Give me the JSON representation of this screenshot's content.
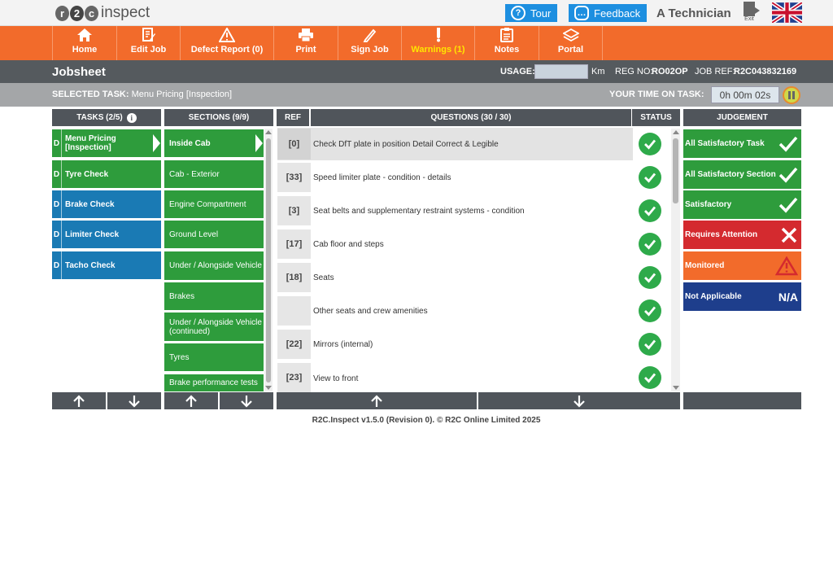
{
  "brand": {
    "logo_letters": [
      "r",
      "2",
      "c"
    ],
    "logo_text": "inspect"
  },
  "topbar": {
    "tour_label": "Tour",
    "feedback_label": "Feedback",
    "user_name": "A Technician",
    "exit_label": "Exit"
  },
  "nav": [
    {
      "label": "Home",
      "icon": "home-icon"
    },
    {
      "label": "Edit Job",
      "icon": "edit-job-icon"
    },
    {
      "label": "Defect Report (0)",
      "icon": "warning-triangle-icon"
    },
    {
      "label": "Print",
      "icon": "printer-icon"
    },
    {
      "label": "Sign Job",
      "icon": "pen-icon"
    },
    {
      "label": "Warnings (1)",
      "icon": "exclamation-icon"
    },
    {
      "label": "Notes",
      "icon": "clipboard-icon"
    },
    {
      "label": "Portal",
      "icon": "layers-icon"
    }
  ],
  "jobbar": {
    "title": "Jobsheet",
    "usage_label": "USAGE:",
    "usage_value": "",
    "usage_unit": "Km",
    "reg_label": "REG NO:",
    "reg_value": "RO02OP",
    "jobref_label": "JOB REF:",
    "jobref_value": "R2C043832169"
  },
  "taskbar": {
    "selected_label": "SELECTED TASK:",
    "selected_value": "Menu Pricing [Inspection]",
    "time_label": "YOUR TIME ON TASK:",
    "time_value": "0h 00m 02s"
  },
  "headers": {
    "tasks": "TASKS (2/5)",
    "sections": "SECTIONS (9/9)",
    "ref": "REF",
    "questions": "QUESTIONS (30 / 30)",
    "status": "STATUS",
    "judgement": "JUDGEMENT"
  },
  "tasks": [
    {
      "prefix": "D",
      "label": "Menu Pricing [Inspection]",
      "color": "#2e9c3c",
      "selected": true
    },
    {
      "prefix": "D",
      "label": "Tyre Check",
      "color": "#2e9c3c"
    },
    {
      "prefix": "D",
      "label": "Brake Check",
      "color": "#1a7ab4"
    },
    {
      "prefix": "D",
      "label": "Limiter Check",
      "color": "#1a7ab4"
    },
    {
      "prefix": "D",
      "label": "Tacho Check",
      "color": "#1a7ab4"
    }
  ],
  "sections": [
    {
      "label": "Inside Cab",
      "selected": true
    },
    {
      "label": "Cab - Exterior"
    },
    {
      "label": "Engine Compartment"
    },
    {
      "label": "Ground Level"
    },
    {
      "label": "Under / Alongside Vehicle"
    },
    {
      "label": "Brakes"
    },
    {
      "label": "Under / Alongside Vehicle (continued)"
    },
    {
      "label": "Tyres"
    },
    {
      "label": "Brake performance tests"
    }
  ],
  "questions": [
    {
      "ref": "[0]",
      "text": "Check DfT plate in position Detail Correct & Legible",
      "status": "satisfactory"
    },
    {
      "ref": "[33]",
      "text": "Speed limiter plate - condition - details",
      "status": "satisfactory"
    },
    {
      "ref": "[3]",
      "text": "Seat belts and supplementary restraint systems - condition",
      "status": "satisfactory"
    },
    {
      "ref": "[17]",
      "text": "Cab floor and steps",
      "status": "satisfactory"
    },
    {
      "ref": "[18]",
      "text": "Seats",
      "status": "satisfactory"
    },
    {
      "ref": "",
      "text": "Other seats and crew amenities",
      "status": "satisfactory"
    },
    {
      "ref": "[22]",
      "text": "Mirrors (internal)",
      "status": "satisfactory"
    },
    {
      "ref": "[23]",
      "text": "View to front",
      "status": "satisfactory"
    }
  ],
  "judgements": [
    {
      "label": "All Satisfactory Task",
      "icon": "check-icon",
      "color": "#2e9c3c"
    },
    {
      "label": "All Satisfactory Section",
      "icon": "check-icon",
      "color": "#2e9c3c"
    },
    {
      "label": "Satisfactory",
      "icon": "check-icon",
      "color": "#2e9c3c"
    },
    {
      "label": "Requires Attention",
      "icon": "cross-icon",
      "color": "#d42a2f"
    },
    {
      "label": "Monitored",
      "icon": "warning-triangle-icon",
      "color": "#f26b2b"
    },
    {
      "label": "Not Applicable",
      "icon_text": "N/A",
      "color": "#1e3e8c"
    }
  ],
  "footer": "R2C.Inspect v1.5.0 (Revision 0). © R2C Online Limited 2025",
  "colors": {
    "orange": "#f26b2b",
    "green": "#2e9c3c",
    "blue": "#1a7ab4",
    "red": "#d42a2f",
    "navy": "#1e3e8c",
    "dark": "#50555b"
  }
}
